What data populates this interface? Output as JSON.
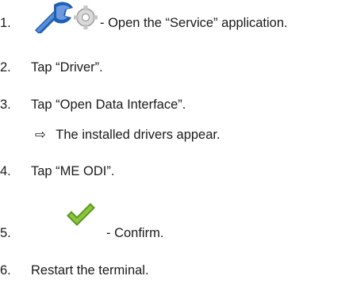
{
  "steps": [
    {
      "num": "1.",
      "text": "- Open the “Service” application.",
      "icon": "service-wrench-icon"
    },
    {
      "num": "2.",
      "text": "Tap “Driver”."
    },
    {
      "num": "3.",
      "text": "Tap “Open Data Interface”.",
      "result": {
        "arrow": "⇨",
        "text": "The installed drivers appear."
      }
    },
    {
      "num": "4.",
      "text": "Tap “ME ODI”."
    },
    {
      "num": "5.",
      "text": "- Confirm.",
      "icon": "confirm-checkmark-icon"
    },
    {
      "num": "6.",
      "text": "Restart the terminal."
    }
  ],
  "colors": {
    "text": "#1a1a1a",
    "wrench_blue": "#1f5fb4",
    "check_green": "#7fb23a"
  }
}
